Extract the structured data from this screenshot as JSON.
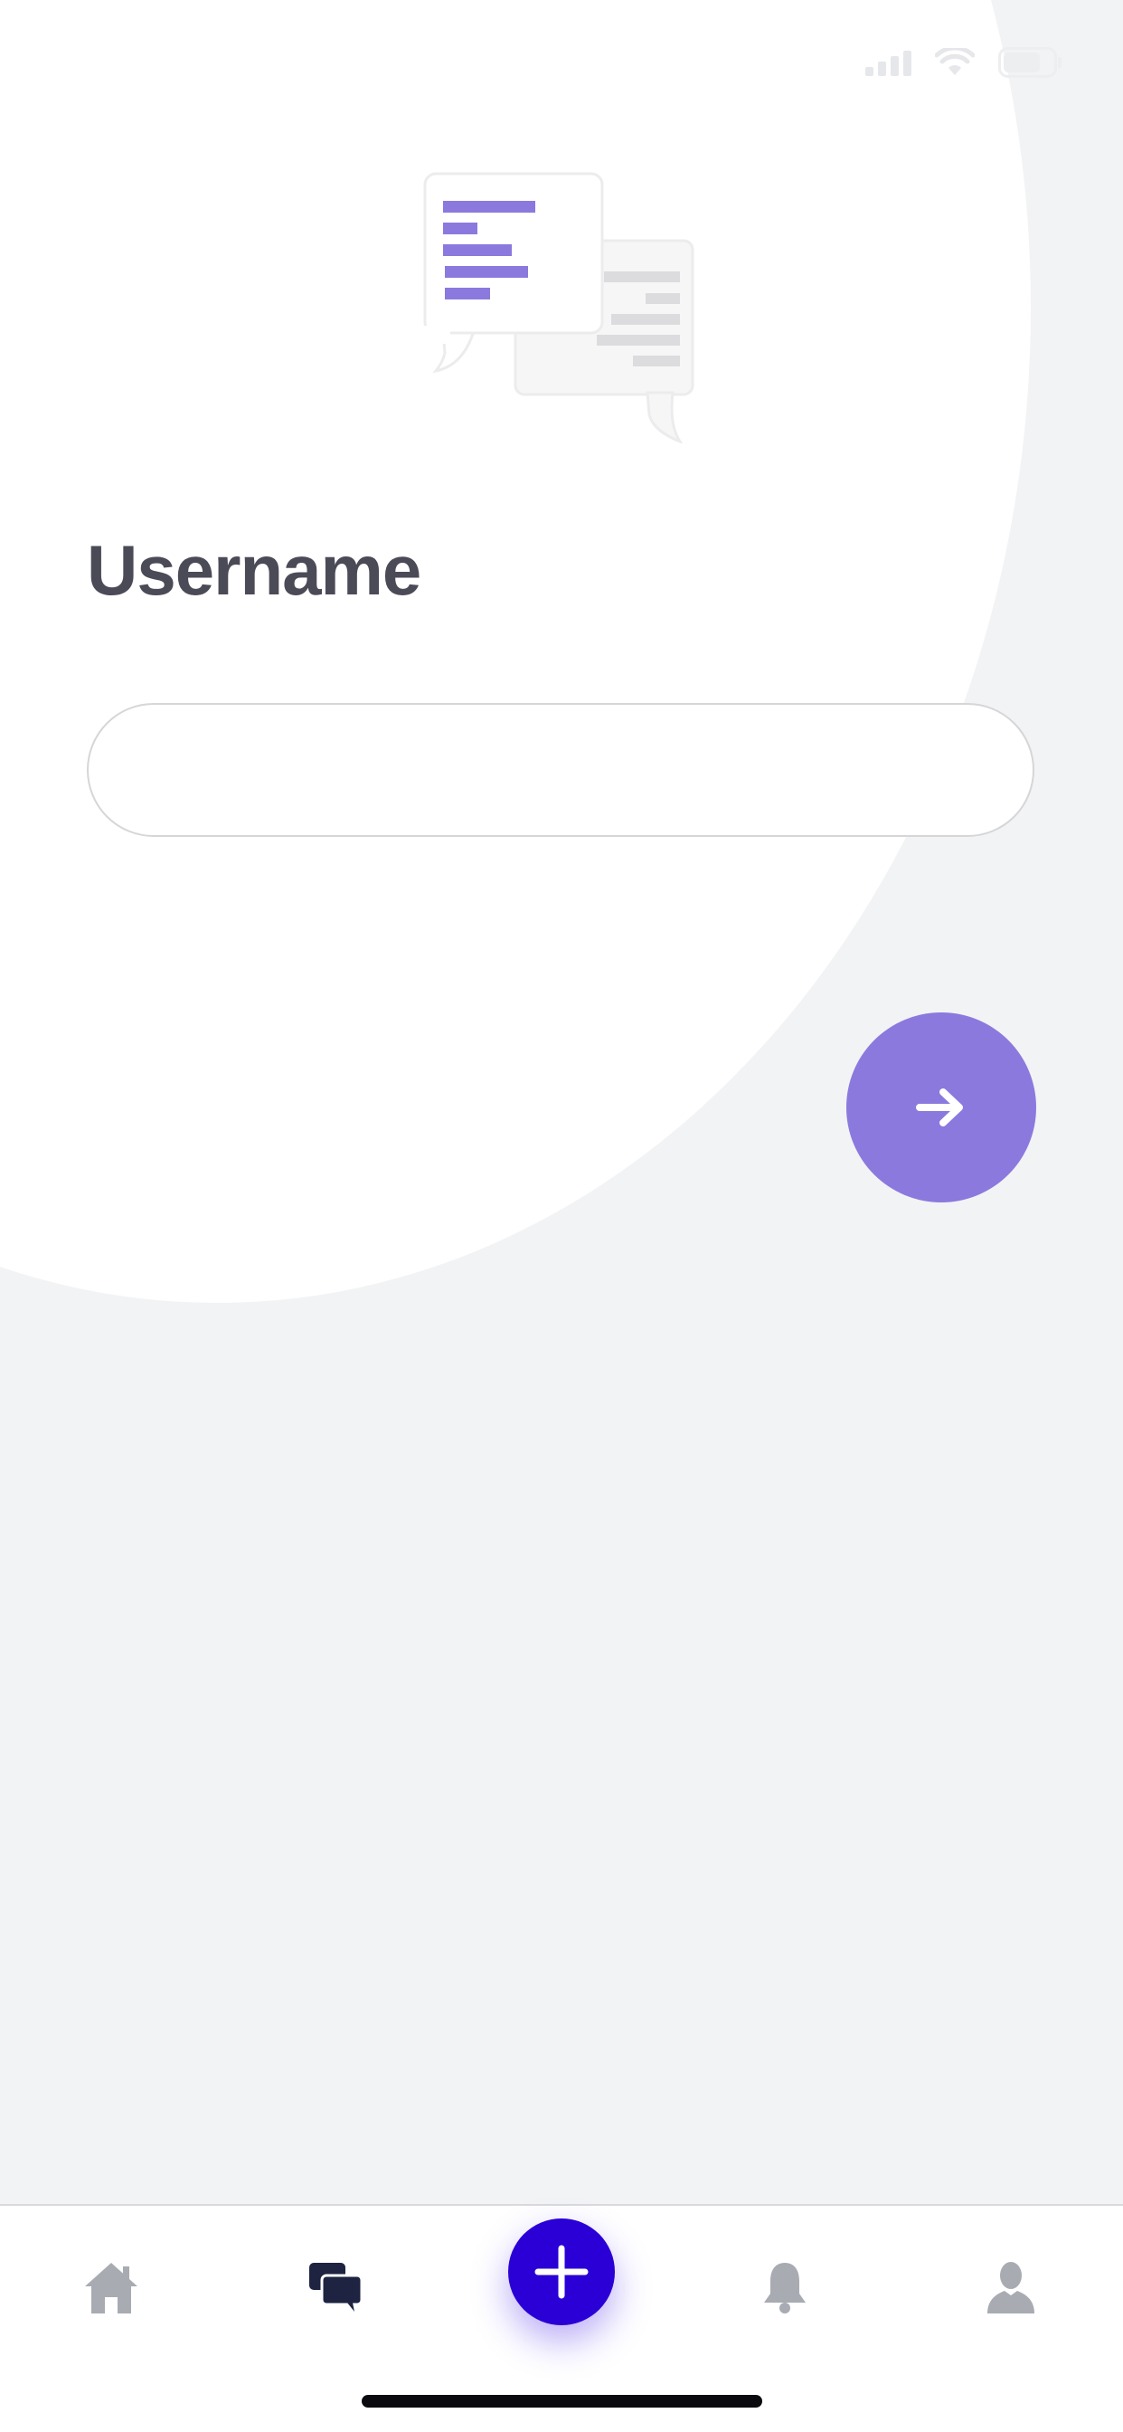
{
  "form": {
    "title": "Username",
    "username_value": "",
    "username_placeholder": ""
  },
  "icons": {
    "next": "arrow-right-icon",
    "illustration": "chat-bubbles-illustration",
    "tabs": [
      "home-icon",
      "chat-icon",
      "plus-icon",
      "bell-icon",
      "profile-icon"
    ]
  },
  "tab_bar": {
    "active_tab": "chat"
  },
  "colors": {
    "accent": "#8b79de",
    "primary": "#2a00d6",
    "title": "#4b4a57",
    "tab_active": "#1d2340",
    "tab_inactive": "#a9abb3",
    "background": "#f2f3f5"
  }
}
